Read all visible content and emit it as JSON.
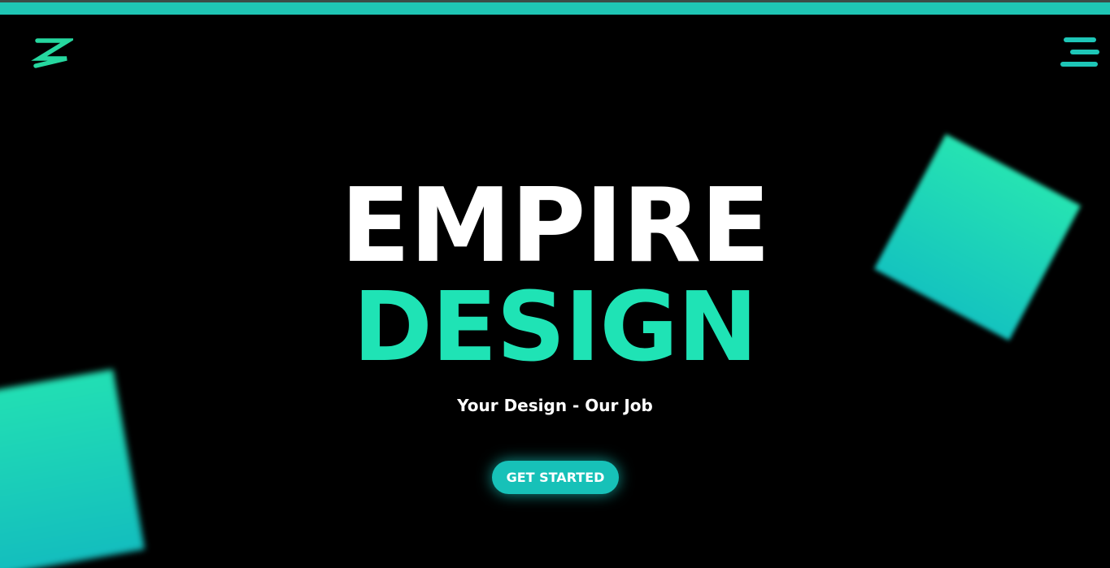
{
  "header": {
    "logo_icon": "lightning-bolt-icon",
    "menu_icon": "hamburger-menu-icon"
  },
  "hero": {
    "title_line1": "EMPIRE",
    "title_line2": "DESIGN",
    "tagline": "Your Design - Our Job",
    "cta_label": "GET STARTED"
  },
  "colors": {
    "background": "#000000",
    "accent": "#1fe3b5",
    "accent_dark": "#17c1b8",
    "text": "#ffffff"
  }
}
